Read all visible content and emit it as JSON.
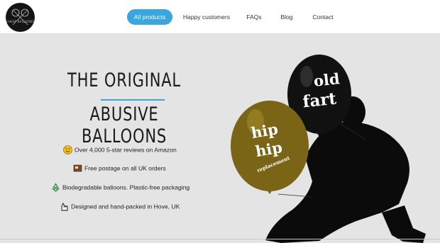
{
  "logo": {
    "text": "CHEAP BALLOONS"
  },
  "nav": {
    "items": [
      {
        "label": "All products",
        "active": true
      },
      {
        "label": "Happy customers",
        "active": false
      },
      {
        "label": "FAQs",
        "active": false
      },
      {
        "label": "Blog",
        "active": false
      },
      {
        "label": "Contact",
        "active": false
      }
    ]
  },
  "hero": {
    "headline_line1": "THE ORIGINAL",
    "headline_line2": "ABUSIVE BALLOONS",
    "features": [
      {
        "icon": "star-emoji-icon",
        "text": "Over 4,000 5-star reviews on Amazon"
      },
      {
        "icon": "parcel-icon",
        "text": "Free postage on all UK orders"
      },
      {
        "icon": "recycle-icon",
        "text": "Biodegradable balloons. Plastic-free packaging"
      },
      {
        "icon": "hand-icon",
        "text": "Designed and hand-packed in Hove, UK"
      }
    ],
    "balloons": [
      {
        "line1": "old",
        "line2": "fart",
        "color": "#111111"
      },
      {
        "line1": "hip",
        "line2": "hip",
        "line3": "replacement",
        "color": "#7a6416"
      }
    ]
  },
  "colors": {
    "accent": "#3aa6dd",
    "background": "#e4e4e4",
    "header": "#ffffff"
  }
}
